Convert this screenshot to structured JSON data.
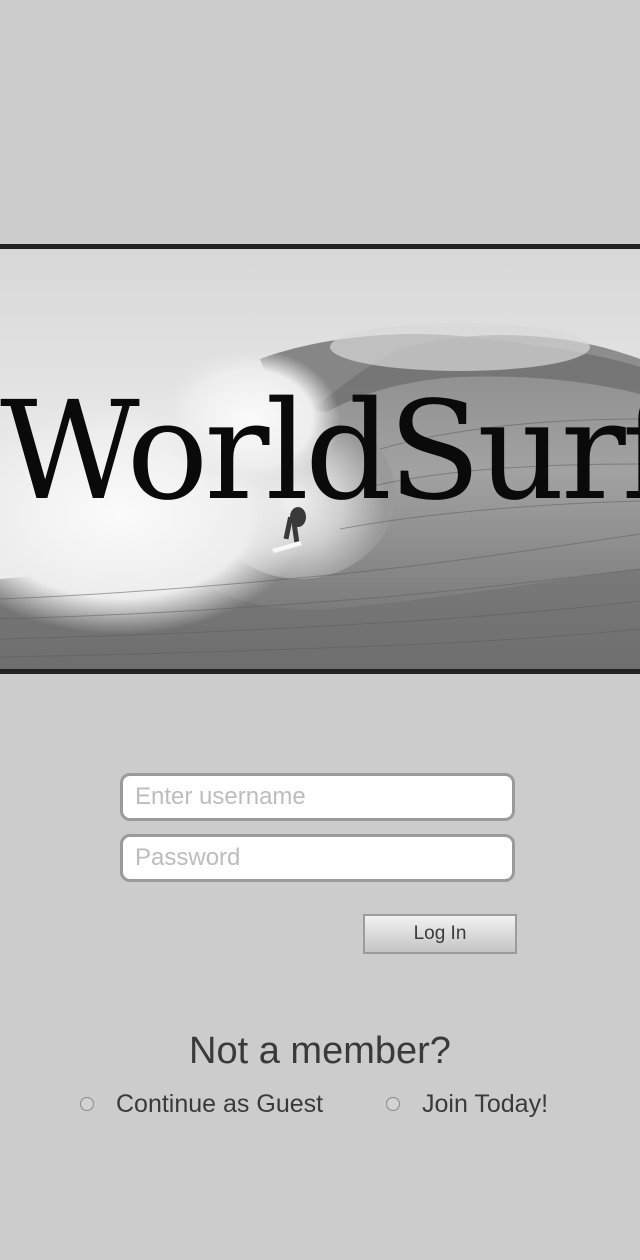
{
  "brand": {
    "title": "WorldSurf",
    "background_image": "surfer-in-barrel-wave-photo"
  },
  "login": {
    "username_placeholder": "Enter username",
    "password_placeholder": "Password",
    "login_label": "Log In"
  },
  "signup": {
    "prompt": "Not a member?",
    "options": [
      {
        "label": "Continue as Guest",
        "selected": false
      },
      {
        "label": "Join Today!",
        "selected": false
      }
    ]
  },
  "colors": {
    "page_background": "#cccccc",
    "band_border": "#222222",
    "text": "#3a3a3a",
    "input_border": "#9a9a9a",
    "placeholder": "#bdbdbd"
  }
}
